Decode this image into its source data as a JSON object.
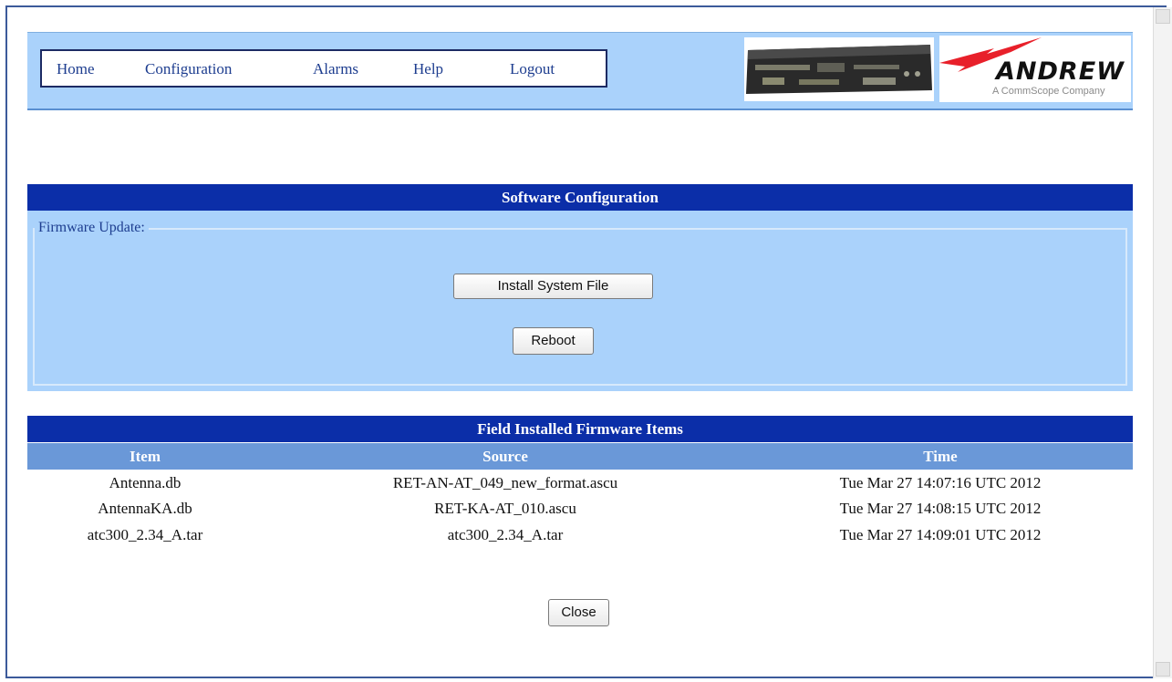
{
  "nav": {
    "items": [
      "Home",
      "Configuration",
      "Alarms",
      "Help",
      "Logout"
    ]
  },
  "logo": {
    "name": "ANDREW",
    "subtitle": "A CommScope Company"
  },
  "software_section": {
    "title": "Software Configuration",
    "fieldset_legend": "Firmware Update:",
    "install_button": "Install System File",
    "reboot_button": "Reboot"
  },
  "firmware_table": {
    "title": "Field Installed Firmware Items",
    "columns": [
      "Item",
      "Source",
      "Time"
    ],
    "rows": [
      {
        "item": "Antenna.db",
        "source": "RET-AN-AT_049_new_format.ascu",
        "time": "Tue Mar 27 14:07:16 UTC 2012"
      },
      {
        "item": "AntennaKA.db",
        "source": "RET-KA-AT_010.ascu",
        "time": "Tue Mar 27 14:08:15 UTC 2012"
      },
      {
        "item": "atc300_2.34_A.tar",
        "source": "atc300_2.34_A.tar",
        "time": "Tue Mar 27 14:09:01 UTC 2012"
      }
    ]
  },
  "close_button": "Close",
  "colors": {
    "header_bg": "#aad2fb",
    "section_header_bg": "#0b2ea8",
    "table_header_bg": "#6a98d8",
    "nav_text": "#1d3d8f",
    "logo_red": "#e8202a"
  }
}
